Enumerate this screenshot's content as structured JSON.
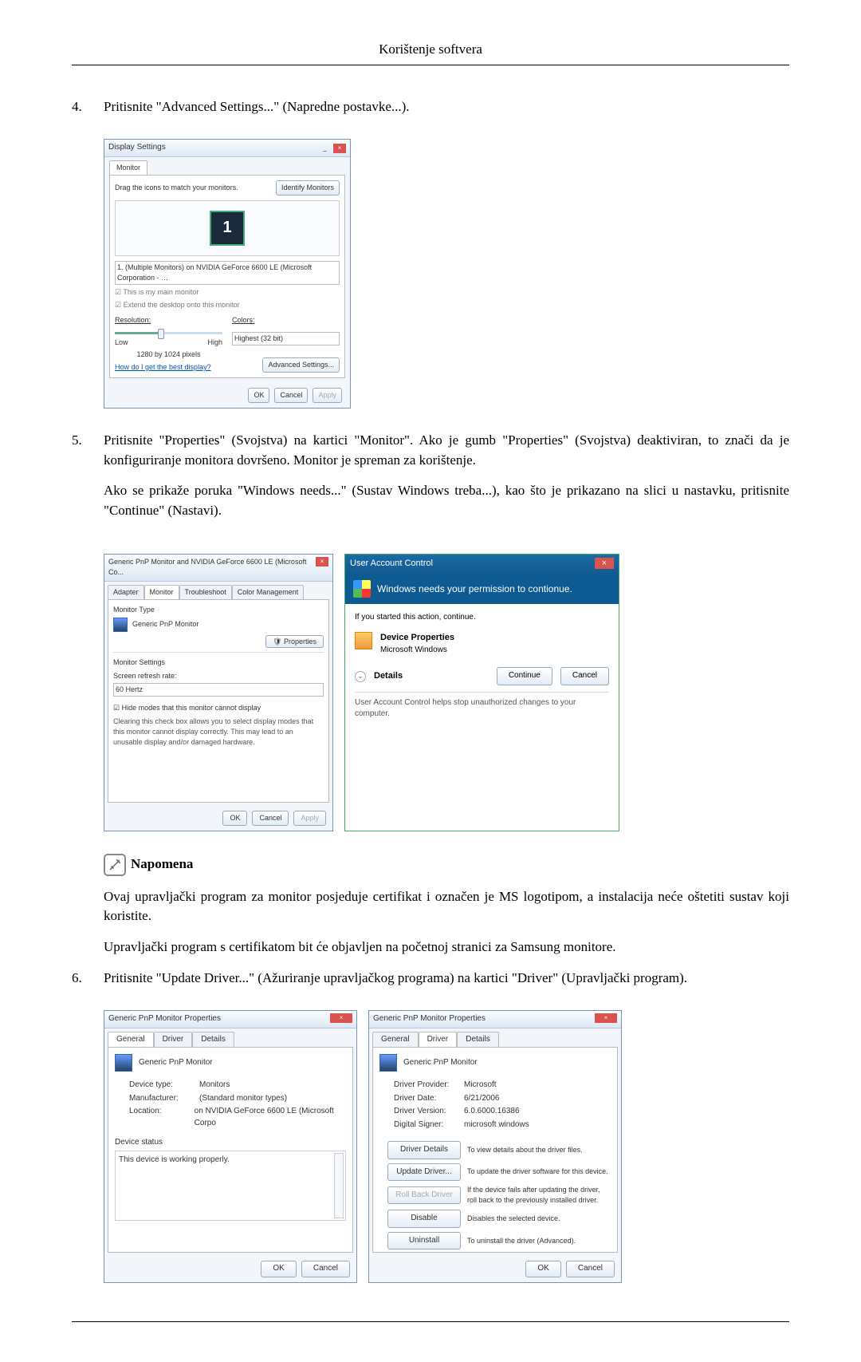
{
  "doc": {
    "header": "Korištenje softvera",
    "step4_num": "4.",
    "step4_text": "Pritisnite \"Advanced Settings...\" (Napredne postavke...).",
    "step5_num": "5.",
    "step5_text": "Pritisnite \"Properties\" (Svojstva) na kartici \"Monitor\". Ako je gumb \"Properties\" (Svojstva) deaktiviran, to znači da je konfiguriranje monitora dovršeno. Monitor je spreman za korištenje.",
    "step5_para2": "Ako se prikaže poruka \"Windows needs...\" (Sustav Windows treba...), kao što je prikazano na slici u nastavku, pritisnite \"Continue\" (Nastavi).",
    "note_heading": "Napomena",
    "note_p1": "Ovaj upravljački program za monitor posjeduje certifikat i označen je MS logotipom, a instalacija neće oštetiti sustav koji koristite.",
    "note_p2": "Upravljački program s certifikatom bit će objavljen na početnoj stranici za Samsung monitore.",
    "step6_num": "6.",
    "step6_text": "Pritisnite \"Update Driver...\" (Ažuriranje upravljačkog programa) na kartici \"Driver\" (Upravljački program)."
  },
  "ds": {
    "title": "Display Settings",
    "tab": "Monitor",
    "drag": "Drag the icons to match your monitors.",
    "identify": "Identify Monitors",
    "mon1": "1",
    "dropdown": "1. (Multiple Monitors) on NVIDIA GeForce 6600 LE (Microsoft Corporation - …",
    "chk1": "This is my main monitor",
    "chk2": "Extend the desktop onto this monitor",
    "res_label": "Resolution:",
    "col_label": "Colors:",
    "low": "Low",
    "high": "High",
    "colors": "Highest (32 bit)",
    "res_cur": "1280 by 1024 pixels",
    "help_link": "How do I get the best display?",
    "adv": "Advanced Settings...",
    "ok": "OK",
    "cancel": "Cancel",
    "apply": "Apply"
  },
  "mon": {
    "title": "Generic PnP Monitor and NVIDIA GeForce 6600 LE (Microsoft Co...",
    "t_adapter": "Adapter",
    "t_monitor": "Monitor",
    "t_trouble": "Troubleshoot",
    "t_color": "Color Management",
    "grp_type": "Monitor Type",
    "mon_name": "Generic PnP Monitor",
    "props": "Properties",
    "grp_set": "Monitor Settings",
    "refresh_label": "Screen refresh rate:",
    "refresh_val": "60 Hertz",
    "hide_chk": "Hide modes that this monitor cannot display",
    "hide_note": "Clearing this check box allows you to select display modes that this monitor cannot display correctly. This may lead to an unusable display and/or damaged hardware.",
    "ok": "OK",
    "cancel": "Cancel",
    "apply": "Apply"
  },
  "uac": {
    "title": "User Account Control",
    "banner": "Windows needs your permission to contionue.",
    "line1": "If you started this action, continue.",
    "prog_name": "Device Properties",
    "prog_pub": "Microsoft Windows",
    "details": "Details",
    "cont": "Continue",
    "cancel": "Cancel",
    "foot": "User Account Control helps stop unauthorized changes to your computer."
  },
  "drvA": {
    "title": "Generic PnP Monitor Properties",
    "t_general": "General",
    "t_driver": "Driver",
    "t_details": "Details",
    "name": "Generic PnP Monitor",
    "k_devtype": "Device type:",
    "v_devtype": "Monitors",
    "k_manu": "Manufacturer:",
    "v_manu": "(Standard monitor types)",
    "k_loc": "Location:",
    "v_loc": "on NVIDIA GeForce 6600 LE (Microsoft Corpo",
    "dev_status_label": "Device status",
    "dev_status": "This device is working properly.",
    "ok": "OK",
    "cancel": "Cancel"
  },
  "drvB": {
    "title": "Generic PnP Monitor Properties",
    "t_general": "General",
    "t_driver": "Driver",
    "t_details": "Details",
    "name": "Generic PnP Monitor",
    "k_prov": "Driver Provider:",
    "v_prov": "Microsoft",
    "k_date": "Driver Date:",
    "v_date": "6/21/2006",
    "k_ver": "Driver Version:",
    "v_ver": "6.0.6000.16386",
    "k_sign": "Digital Signer:",
    "v_sign": "microsoft windows",
    "b_details": "Driver Details",
    "d_details": "To view details about the driver files.",
    "b_update": "Update Driver...",
    "d_update": "To update the driver software for this device.",
    "b_rollback": "Roll Back Driver",
    "d_rollback": "If the device fails after updating the driver, roll back to the previously installed driver.",
    "b_disable": "Disable",
    "d_disable": "Disables the selected device.",
    "b_uninstall": "Uninstall",
    "d_uninstall": "To uninstall the driver (Advanced).",
    "ok": "OK",
    "cancel": "Cancel"
  }
}
